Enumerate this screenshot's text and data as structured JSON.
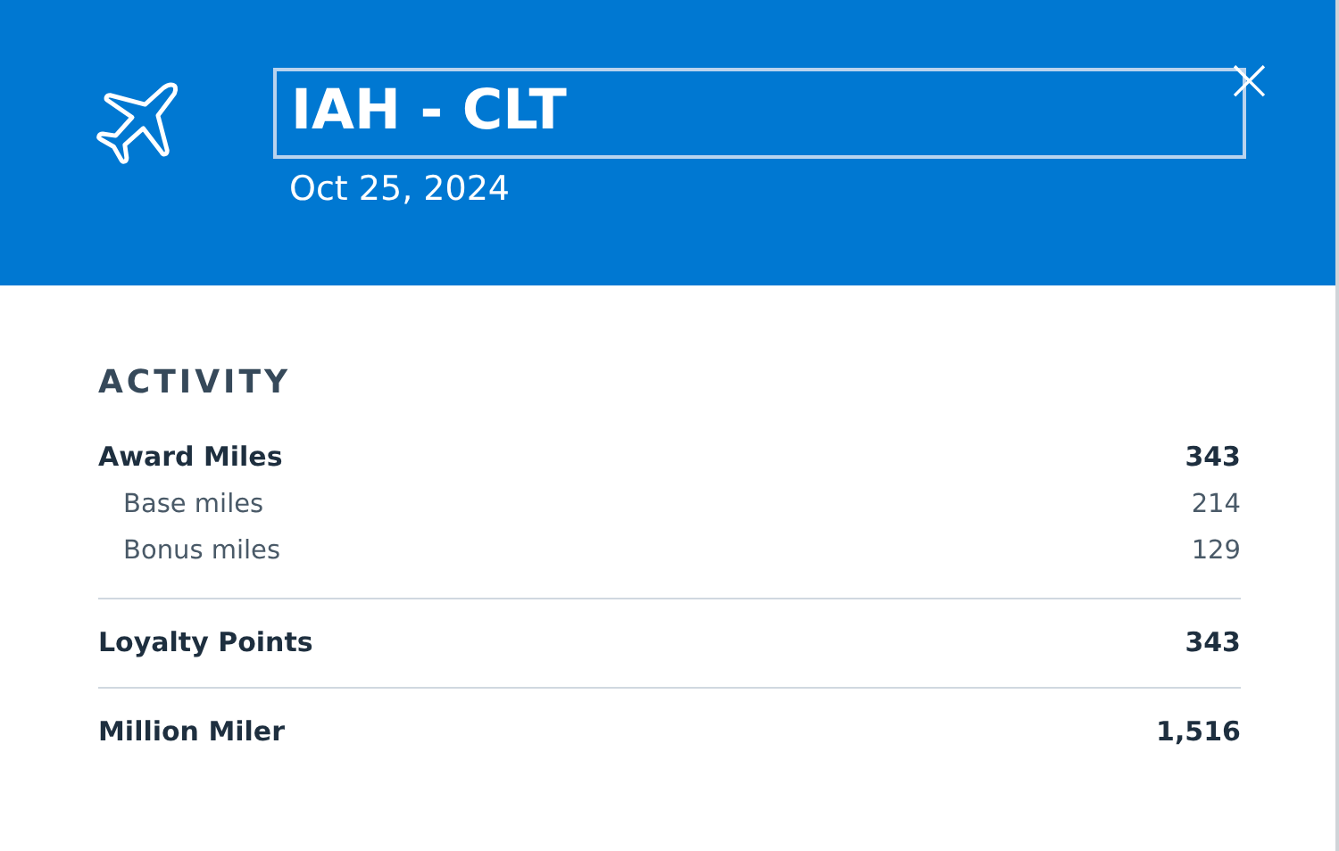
{
  "header": {
    "title": "IAH - CLT",
    "date": "Oct 25, 2024",
    "close": "×"
  },
  "activity": {
    "heading": "ACTIVITY",
    "groups": [
      {
        "rows": [
          {
            "kind": "main",
            "label": "Award Miles",
            "value": "343"
          },
          {
            "kind": "sub",
            "label": "Base miles",
            "value": "214"
          },
          {
            "kind": "sub",
            "label": "Bonus miles",
            "value": "129"
          }
        ]
      },
      {
        "rows": [
          {
            "kind": "main",
            "label": "Loyalty Points",
            "value": "343"
          }
        ]
      },
      {
        "rows": [
          {
            "kind": "main",
            "label": "Million Miler",
            "value": "1,516"
          }
        ]
      }
    ]
  }
}
